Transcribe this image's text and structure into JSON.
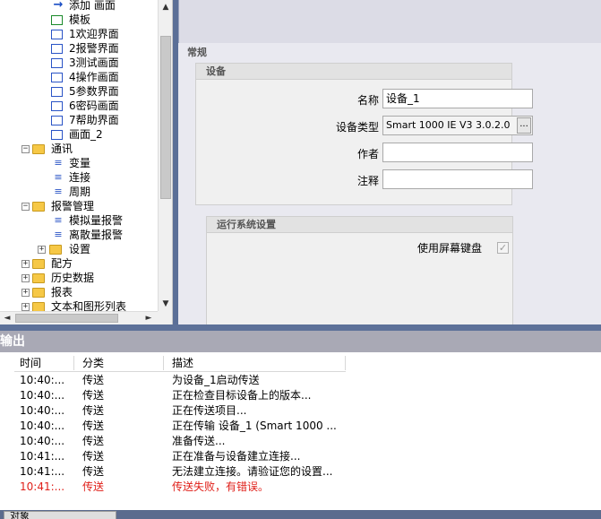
{
  "tree": {
    "rows": [
      {
        "label": "添加 画面",
        "icon": "add-screen-icon"
      },
      {
        "label": "模板",
        "icon": "template-icon"
      },
      {
        "label": "1欢迎界面",
        "icon": "screen-icon"
      },
      {
        "label": "2报警界面",
        "icon": "screen-icon"
      },
      {
        "label": "3测试画面",
        "icon": "screen-icon"
      },
      {
        "label": "4操作画面",
        "icon": "screen-icon"
      },
      {
        "label": "5参数界面",
        "icon": "screen-icon"
      },
      {
        "label": "6密码画面",
        "icon": "screen-icon"
      },
      {
        "label": "7帮助界面",
        "icon": "screen-icon"
      },
      {
        "label": "画面_2",
        "icon": "screen-icon"
      },
      {
        "label": "通讯",
        "icon": "communication-icon",
        "expander": "−"
      },
      {
        "label": "变量",
        "icon": "tags-icon"
      },
      {
        "label": "连接",
        "icon": "connection-icon"
      },
      {
        "label": "周期",
        "icon": "cycle-icon"
      },
      {
        "label": "报警管理",
        "icon": "alarm-folder-icon",
        "expander": "−"
      },
      {
        "label": "模拟量报警",
        "icon": "analog-alarm-icon"
      },
      {
        "label": "离散量报警",
        "icon": "discrete-alarm-icon"
      },
      {
        "label": "设置",
        "icon": "settings-folder-icon",
        "expander": "+"
      },
      {
        "label": "配方",
        "icon": "recipe-folder-icon",
        "expander": "+"
      },
      {
        "label": "历史数据",
        "icon": "history-folder-icon",
        "expander": "+"
      },
      {
        "label": "报表",
        "icon": "report-folder-icon",
        "expander": "+"
      },
      {
        "label": "文本和图形列表",
        "icon": "text-graphic-folder-icon",
        "expander": "+"
      }
    ],
    "scroll_up": "▲",
    "scroll_down": "▼",
    "scroll_left": "◄",
    "scroll_right": "►"
  },
  "properties": {
    "section_title": "常规",
    "device_group": {
      "title": "设备",
      "name_label": "名称",
      "name_value": "设备_1",
      "device_type_label": "设备类型",
      "device_type_value": "Smart 1000 IE V3 3.0.2.0",
      "browse_label": "...",
      "author_label": "作者",
      "author_value": "",
      "comment_label": "注释",
      "comment_value": ""
    },
    "runtime_group": {
      "title": "运行系统设置",
      "screen_keyboard_label": "使用屏幕键盘",
      "screen_keyboard_checked": true,
      "check_mark": "✓"
    }
  },
  "output": {
    "title": "输出",
    "columns": [
      "时间",
      "分类",
      "描述"
    ],
    "rows": [
      {
        "time": "10:40:...",
        "category": "传送",
        "description": "为设备_1启动传送",
        "error": false
      },
      {
        "time": "10:40:...",
        "category": "传送",
        "description": "正在检查目标设备上的版本...",
        "error": false
      },
      {
        "time": "10:40:...",
        "category": "传送",
        "description": "正在传送项目...",
        "error": false
      },
      {
        "time": "10:40:...",
        "category": "传送",
        "description": "正在传输 设备_1 (Smart 1000 ...",
        "error": false
      },
      {
        "time": "10:40:...",
        "category": "传送",
        "description": "准备传送...",
        "error": false
      },
      {
        "time": "10:41:...",
        "category": "传送",
        "description": "正在准备与设备建立连接...",
        "error": false
      },
      {
        "time": "10:41:...",
        "category": "传送",
        "description": "无法建立连接。请验证您的设置...",
        "error": false
      },
      {
        "time": "10:41:...",
        "category": "传送",
        "description": "传送失败，有错误。",
        "error": true
      }
    ],
    "error_color": "#e0201a"
  },
  "bottom_bar": {
    "objects_tab_label": "对象"
  }
}
